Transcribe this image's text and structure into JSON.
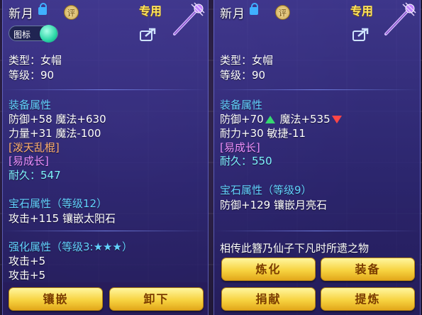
{
  "left": {
    "title": "新月",
    "type_badge": "评",
    "exclusive": "专用",
    "toggle_label": "图标",
    "type_line": "类型：女帽",
    "level_line": "等级：90",
    "equip_attr_title": "装备属性",
    "attr_line1": "防御+58 魔法+630",
    "attr_line2": "力量+31 魔法-100",
    "special1": "[泼天乱棍]",
    "special2": "[易成长]",
    "durability": "耐久：547",
    "gem_title": "宝石属性（等级12）",
    "gem_line": "攻击+115 镶嵌太阳石",
    "enhance_title": "强化属性（等级3:★★★）",
    "enhance_line1": "攻击+5",
    "enhance_line2": "攻击+5",
    "buttons": {
      "inlay": "镶嵌",
      "unequip": "卸下"
    }
  },
  "right": {
    "title": "新月",
    "type_badge": "评",
    "exclusive": "专用",
    "type_line": "类型：女帽",
    "level_line": "等级：90",
    "equip_attr_title": "装备属性",
    "attr_line1_a": "防御+70",
    "attr_line1_b": "魔法+535",
    "attr_line2": "耐力+30 敏捷-11",
    "special1": "[易成长]",
    "durability": "耐久：550",
    "gem_title": "宝石属性（等级9）",
    "gem_line": "防御+129 镶嵌月亮石",
    "description": "相传此簪乃仙子下凡时所遗之物",
    "buttons": {
      "refine": "炼化",
      "equip": "装备",
      "donate": "捐献",
      "extract": "提炼"
    }
  },
  "colors": {
    "section": "#63d2ff",
    "exclusive": "#ffe35a",
    "special_orange": "#ffb070",
    "special_magenta": "#ee90ff",
    "durability": "#7ff4ff",
    "increase": "#36d870",
    "decrease": "#ff4646",
    "button": "#f7d340"
  }
}
